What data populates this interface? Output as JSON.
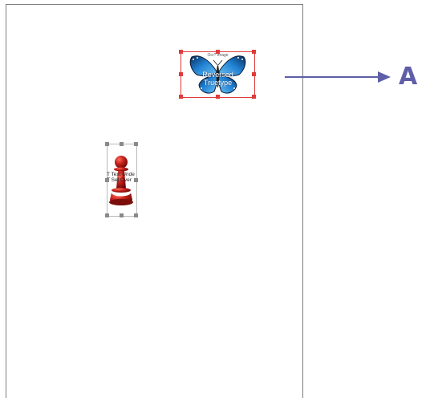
{
  "document": {
    "objects": [
      {
        "kind": "image",
        "name": "butterfly",
        "small_label": "Ocr? Image",
        "overlay_text_line1": "Reversed",
        "overlay_text_line2": "Truetype",
        "selected": true
      },
      {
        "kind": "image",
        "name": "pawn",
        "overlay_text_line1": "T Text Unde",
        "overlay_text_line2": "T Sel Over",
        "selected": false
      }
    ]
  },
  "callout": {
    "letter": "A",
    "color": "#5f5ea8"
  },
  "colors": {
    "selection_handles": "#e03a3a",
    "inactive_handles": "#8a8a8a",
    "pawn": "#b51e1e",
    "butterfly_blue": "#1f7fd1"
  }
}
